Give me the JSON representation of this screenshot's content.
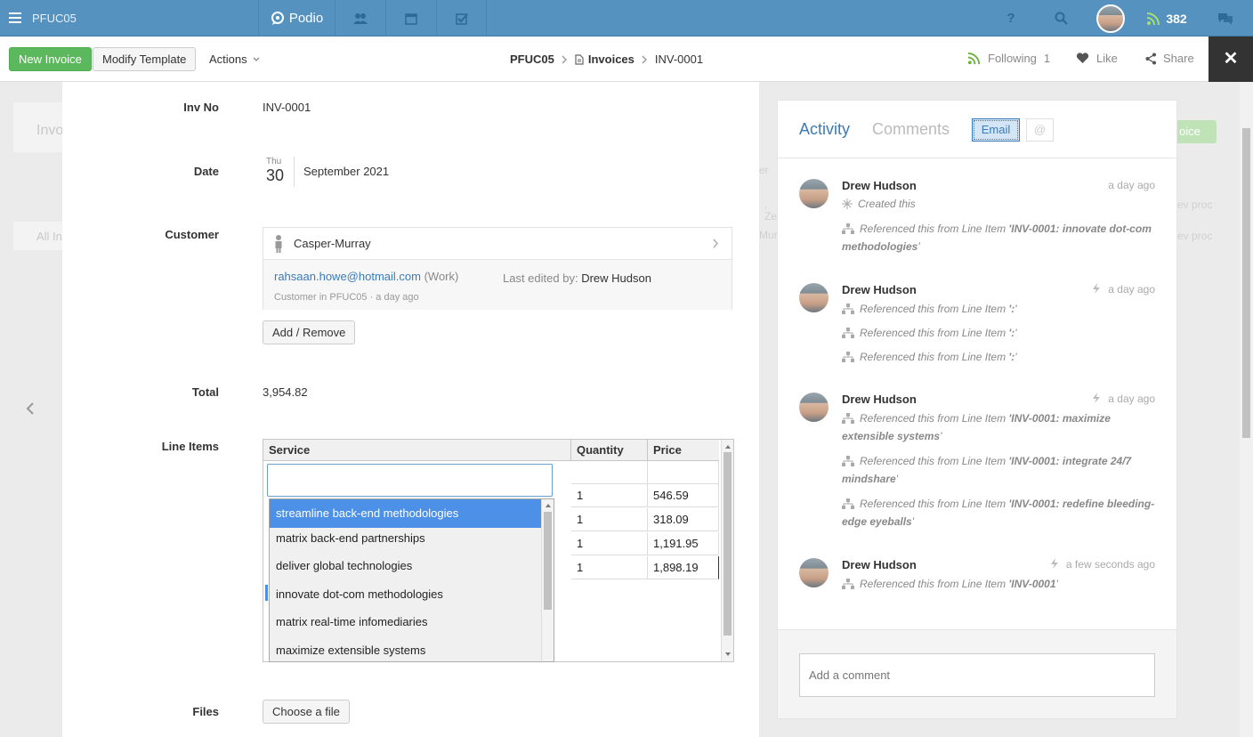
{
  "topbar": {
    "workspace": "PFUC05",
    "logo_text": "Podio",
    "notifications_count": "382",
    "help": "?"
  },
  "toolbar": {
    "new_invoice": "New Invoice",
    "modify_template": "Modify Template",
    "actions": "Actions",
    "breadcrumb": {
      "workspace": "PFUC05",
      "app": "Invoices",
      "item": "INV-0001"
    },
    "following_label": "Following",
    "following_count": "1",
    "like": "Like",
    "share": "Share",
    "close": "✕"
  },
  "background": {
    "left_text_1": "Invo",
    "left_text_2": "All In",
    "right_btn": "oice",
    "right_text_1": "er",
    "right_text_2": ", Ze",
    "right_text_3": "Mur",
    "far_right_1": "ev proc",
    "far_right_2": "ev proc"
  },
  "fields": {
    "inv_no_label": "Inv No",
    "inv_no_value": "INV-0001",
    "date_label": "Date",
    "date_dow": "Thu",
    "date_day": "30",
    "date_monthyear": "September 2021",
    "customer_label": "Customer",
    "customer_name": "Casper-Murray",
    "customer_email": "rahsaan.howe@hotmail.com",
    "customer_email_type": "(Work)",
    "last_edited_label": "Last edited by:",
    "last_edited_by": "Drew Hudson",
    "customer_meta": "Customer in PFUC05 · a day ago",
    "add_remove": "Add / Remove",
    "total_label": "Total",
    "total_value": "3,954.82",
    "line_items_label": "Line Items",
    "files_label": "Files",
    "choose_file": "Choose a file"
  },
  "line_items": {
    "headers": [
      "Service",
      "Quantity",
      "Price"
    ],
    "rows": [
      {
        "quantity": "1",
        "price": "546.59"
      },
      {
        "quantity": "1",
        "price": "318.09"
      },
      {
        "quantity": "1",
        "price": "1,191.95"
      },
      {
        "quantity": "1",
        "price": "1,898.19"
      }
    ],
    "service_input_value": "",
    "dropdown_options": [
      "streamline back-end methodologies",
      "matrix back-end partnerships",
      "deliver global technologies",
      "innovate dot-com methodologies",
      "matrix real-time infomediaries",
      "maximize extensible systems"
    ],
    "selected_option": "streamline back-end methodologies"
  },
  "activity": {
    "tabs": {
      "activity": "Activity",
      "comments": "Comments",
      "email": "Email",
      "at": "@"
    },
    "entries": [
      {
        "name": "Drew Hudson",
        "time": "a day ago",
        "lines": [
          {
            "pre": "Created this",
            "bold": "",
            "post": ""
          },
          {
            "pre": "Referenced this from Line Item ",
            "bold": "'INV-0001: innovate dot-com methodologies",
            "post": "'"
          }
        ]
      },
      {
        "name": "Drew Hudson",
        "time": "a day ago",
        "lines": [
          {
            "pre": "Referenced this from Line Item ",
            "bold": "':",
            "post": "'"
          },
          {
            "pre": "Referenced this from Line Item ",
            "bold": "':",
            "post": "'"
          },
          {
            "pre": "Referenced this from Line Item ",
            "bold": "':",
            "post": "'"
          }
        ]
      },
      {
        "name": "Drew Hudson",
        "time": "a day ago",
        "lines": [
          {
            "pre": "Referenced this from Line Item ",
            "bold": "'INV-0001: maximize extensible systems",
            "post": "'"
          },
          {
            "pre": "Referenced this from Line Item ",
            "bold": "'INV-0001: integrate 24/7 mindshare",
            "post": "'"
          },
          {
            "pre": "Referenced this from Line Item ",
            "bold": "'INV-0001: redefine bleeding-edge eyeballs",
            "post": "'"
          }
        ]
      },
      {
        "name": "Drew Hudson",
        "time": "a few seconds ago",
        "lines": [
          {
            "pre": "Referenced this from Line Item ",
            "bold": "'INV-0001",
            "post": "'"
          }
        ]
      }
    ],
    "comment_placeholder": "Add a comment"
  }
}
